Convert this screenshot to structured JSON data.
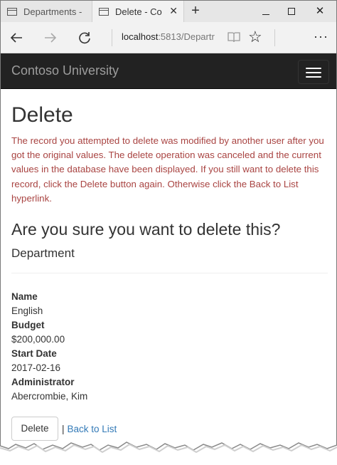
{
  "browser": {
    "tabs": [
      {
        "title": "Departments -",
        "active": false
      },
      {
        "title": "Delete - Co",
        "active": true
      }
    ],
    "new_tab_symbol": "+",
    "url_host": "localhost",
    "url_rest": ":5813/Departr",
    "icons": {
      "back": "back-arrow-icon",
      "forward": "forward-arrow-icon",
      "refresh": "refresh-icon",
      "reading_view": "reading-view-icon",
      "favorite": "star-icon",
      "more": "more-icon"
    }
  },
  "site": {
    "brand": "Contoso University"
  },
  "page": {
    "title": "Delete",
    "error_message": "The record you attempted to delete was modified by another user after you got the original values. The delete operation was canceled and the current values in the database have been displayed. If you still want to delete this record, click the Delete button again. Otherwise click the Back to List hyperlink.",
    "confirm_question": "Are you sure you want to delete this?",
    "entity_name": "Department",
    "details": [
      {
        "label": "Name",
        "value": "English"
      },
      {
        "label": "Budget",
        "value": "$200,000.00"
      },
      {
        "label": "Start Date",
        "value": "2017-02-16"
      },
      {
        "label": "Administrator",
        "value": "Abercrombie, Kim"
      }
    ],
    "delete_button": "Delete",
    "separator": "|",
    "back_link": "Back to List"
  },
  "colors": {
    "navbar_bg": "#222222",
    "brand_text": "#9d9d9d",
    "error_text": "#a94442",
    "link": "#337ab7"
  }
}
